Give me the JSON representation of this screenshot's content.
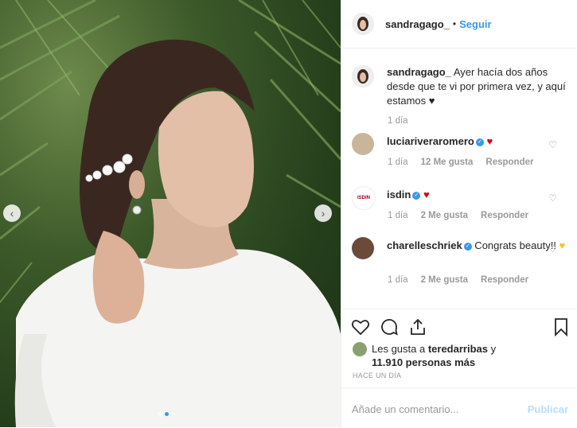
{
  "post": {
    "username": "sandragago_",
    "separator": "•",
    "follow_label": "Seguir",
    "caption_user": "sandragago_",
    "caption_text": " Ayer hacía dos años desde que te vi por primera vez, y aquí estamos ♥",
    "caption_time": "1 día"
  },
  "comments": [
    {
      "user": "luciariveraromero",
      "verified": true,
      "text": "",
      "emoji": "♥",
      "emoji_color": "#d0021b",
      "time": "1 día",
      "likes": "12 Me gusta",
      "reply": "Responder"
    },
    {
      "user": "isdin",
      "verified": true,
      "text": "",
      "emoji": "♥",
      "emoji_color": "#d0021b",
      "time": "1 día",
      "likes": "2 Me gusta",
      "reply": "Responder"
    },
    {
      "user": "charelleschriek",
      "verified": true,
      "text": " Congrats beauty!! ",
      "emoji": "♥",
      "emoji_color": "#f5c518",
      "time": "1 día",
      "likes": "2 Me gusta",
      "reply": "Responder"
    }
  ],
  "likes": {
    "prefix": "Les gusta a ",
    "user": "teredarribas",
    "conj": " y",
    "count": "11.910 personas más"
  },
  "timestamp": "HACE UN DÍA",
  "add_comment": {
    "placeholder": "Añade un comentario...",
    "publish": "Publicar"
  },
  "icons": {
    "like": "heart-icon",
    "comment": "comment-icon",
    "share": "share-icon",
    "save": "bookmark-icon",
    "prev": "chevron-left-icon",
    "next": "chevron-right-icon"
  },
  "colors": {
    "accent": "#3897f0",
    "publish_disabled": "#b2dffc"
  }
}
